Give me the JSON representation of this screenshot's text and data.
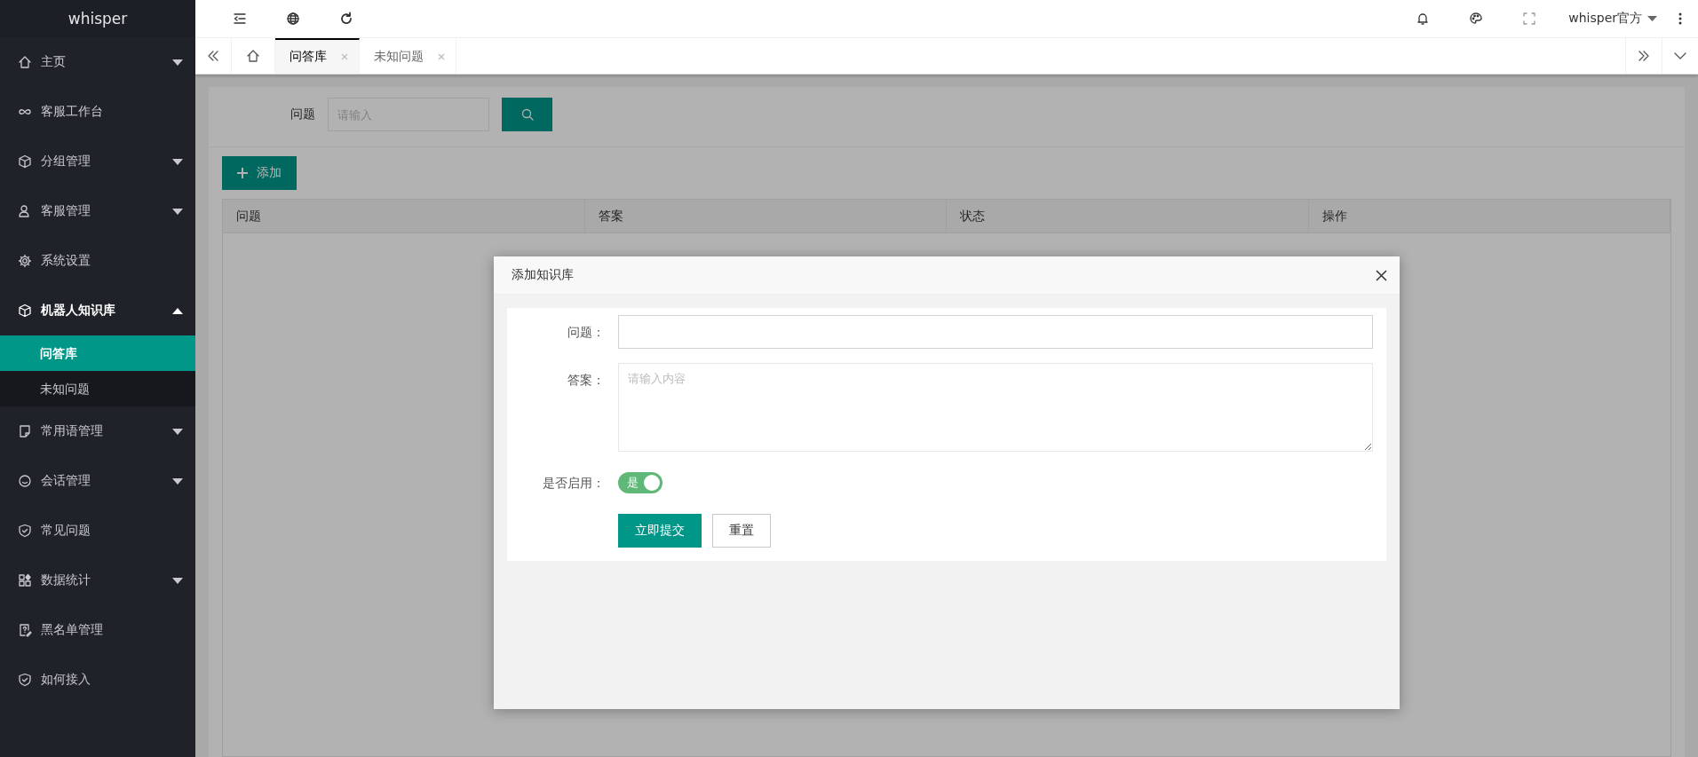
{
  "sidebar": {
    "logo": "whisper",
    "items": [
      {
        "label": "主页",
        "expanded": false
      },
      {
        "label": "客服工作台"
      },
      {
        "label": "分组管理",
        "expanded": false
      },
      {
        "label": "客服管理",
        "expanded": false
      },
      {
        "label": "系统设置"
      },
      {
        "label": "机器人知识库",
        "expanded": true,
        "children": [
          {
            "label": "问答库",
            "selected": true
          },
          {
            "label": "未知问题",
            "selected": false
          }
        ]
      },
      {
        "label": "常用语管理",
        "expanded": false
      },
      {
        "label": "会话管理",
        "expanded": false
      },
      {
        "label": "常见问题"
      },
      {
        "label": "数据统计",
        "expanded": false
      },
      {
        "label": "黑名单管理"
      },
      {
        "label": "如何接入"
      }
    ]
  },
  "header": {
    "user": "whisper官方"
  },
  "tabs": [
    {
      "label": "问答库",
      "selected": true
    },
    {
      "label": "未知问题",
      "selected": false
    }
  ],
  "search": {
    "label": "问题",
    "placeholder": "请输入"
  },
  "add_button": "添加",
  "table": {
    "columns": [
      "问题",
      "答案",
      "状态",
      "操作"
    ]
  },
  "modal": {
    "title": "添加知识库",
    "fields": [
      {
        "kind": "input",
        "label": "问题："
      },
      {
        "kind": "textarea",
        "label": "答案：",
        "placeholder": "请输入内容"
      },
      {
        "kind": "switch",
        "label": "是否启用：",
        "on": true,
        "text": "是"
      }
    ],
    "buttons": [
      {
        "kind": "primary",
        "label": "立即提交"
      },
      {
        "kind": "plain",
        "label": "重置"
      }
    ]
  }
}
